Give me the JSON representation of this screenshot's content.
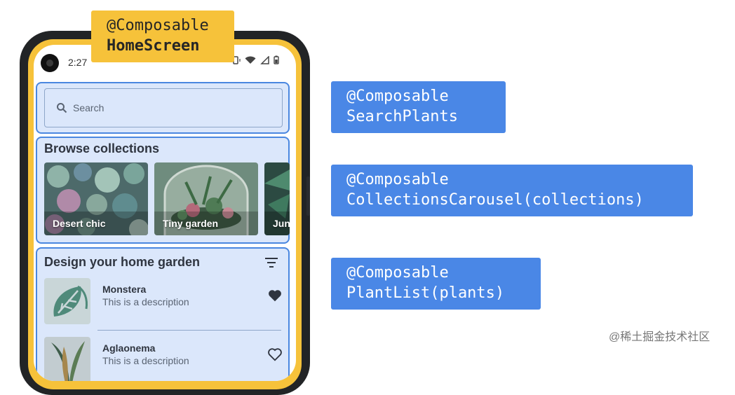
{
  "status_bar": {
    "time": "2:27"
  },
  "search": {
    "placeholder": "Search"
  },
  "collections": {
    "title": "Browse collections",
    "items": [
      {
        "label": "Desert chic"
      },
      {
        "label": "Tiny garden"
      },
      {
        "label": "Jung"
      }
    ]
  },
  "plants": {
    "title": "Design your home garden",
    "items": [
      {
        "name": "Monstera",
        "description": "This is a description",
        "favorite": true
      },
      {
        "name": "Aglaonema",
        "description": "This is a description",
        "favorite": false
      }
    ]
  },
  "code_labels": {
    "home": {
      "line1": "@Composable",
      "line2": "HomeScreen"
    },
    "search": {
      "line1": "@Composable",
      "line2": "SearchPlants"
    },
    "carousel": {
      "line1": "@Composable",
      "line2": "CollectionsCarousel(collections)"
    },
    "plants": {
      "line1": "@Composable",
      "line2": "PlantList(plants)"
    }
  },
  "watermark": "@稀土掘金技术社区",
  "colors": {
    "accent_yellow": "#f6c23a",
    "accent_blue": "#4a87e6",
    "region_fill": "#dbe7fb"
  }
}
